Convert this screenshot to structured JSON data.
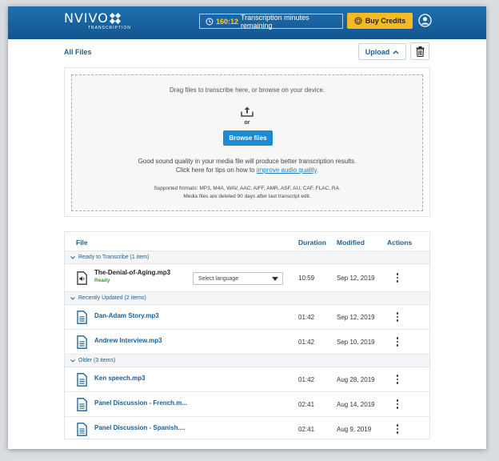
{
  "header": {
    "logo_text": "NVIVO",
    "logo_sub": "TRANSCRIPTION",
    "minutes_value": "160:12",
    "minutes_label": "Transcription minutes remaining",
    "buy_label": "Buy Credits"
  },
  "toolbar": {
    "title": "All Files",
    "upload_label": "Upload"
  },
  "dropzone": {
    "title": "Drag files to transcribe here, or browse on your device.",
    "or": "or",
    "browse_label": "Browse files",
    "quality_line1": "Good sound quality in your media file will produce better transcription results.",
    "quality_line2_prefix": "Click here for tips on how to ",
    "quality_link": "improve audio quality",
    "quality_line2_suffix": ".",
    "formats": "Supported formats: MP3, M4A, WAV, AAC, AIFF, AMR, ASF, AU, CAF, FLAC, RA.",
    "retention": "Media files are deleted 90 days after last transcript edit."
  },
  "table": {
    "headers": {
      "file": "File",
      "duration": "Duration",
      "modified": "Modified",
      "actions": "Actions"
    },
    "groups": [
      {
        "label": "Ready to Transcribe (1 item)"
      },
      {
        "label": "Recently Updated (2 items)"
      },
      {
        "label": "Older (3 items)"
      }
    ],
    "rows": [
      {
        "name": "The-Denial-of-Aging.mp3",
        "status": "Ready",
        "language_placeholder": "Select language",
        "duration": "10:59",
        "modified": "Sep 12, 2019"
      },
      {
        "name": "Dan-Adam Story.mp3",
        "duration": "01:42",
        "modified": "Sep 12, 2019"
      },
      {
        "name": "Andrew Interview.mp3",
        "duration": "01:42",
        "modified": "Sep 10, 2019"
      },
      {
        "name": "Ken speech.mp3",
        "duration": "01:42",
        "modified": "Aug 28, 2019"
      },
      {
        "name": "Panel Discussion - French.m...",
        "duration": "02:41",
        "modified": "Aug 14, 2019"
      },
      {
        "name": "Panel Discussion - Spanish....",
        "duration": "02:41",
        "modified": "Aug 9, 2019"
      }
    ]
  },
  "colors": {
    "header_blue": "#13568f",
    "accent_yellow": "#f5b921",
    "link_blue": "#1a5e96",
    "button_blue": "#1a8ad4",
    "ready_green": "#2e9c3a"
  },
  "icons": {
    "clock": "clock-icon",
    "coin": "coin-icon",
    "avatar": "user-avatar-icon",
    "trash": "trash-icon",
    "upload": "upload-icon",
    "audio_file": "audio-file-icon",
    "document": "document-icon",
    "kebab": "kebab-menu-icon"
  }
}
